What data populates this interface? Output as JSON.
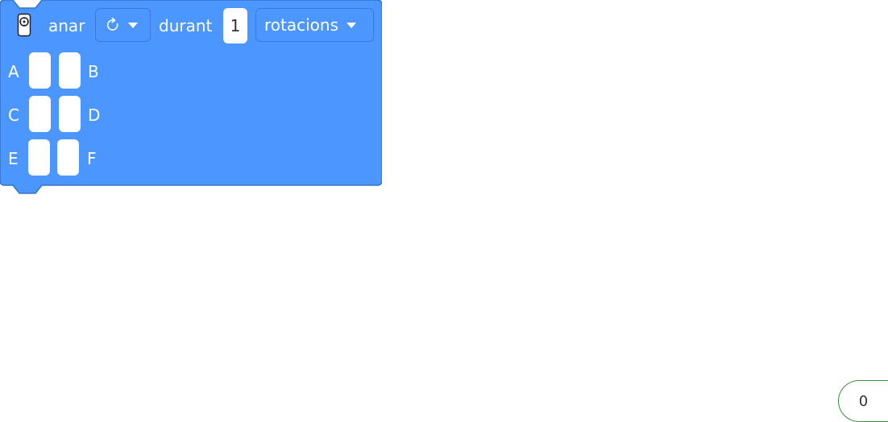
{
  "block": {
    "icon": "motor-device-icon",
    "verb_label": "anar",
    "direction_icon": "clockwise-arrow-icon",
    "during_label": "durant",
    "amount_value": "1",
    "unit_selected": "rotacions",
    "ports": [
      "A",
      "B",
      "C",
      "D",
      "E",
      "F"
    ],
    "color": "#4c97ff",
    "border_color": "#3373cc"
  },
  "counter": {
    "value": "0",
    "border_color": "#3a8f3a"
  }
}
